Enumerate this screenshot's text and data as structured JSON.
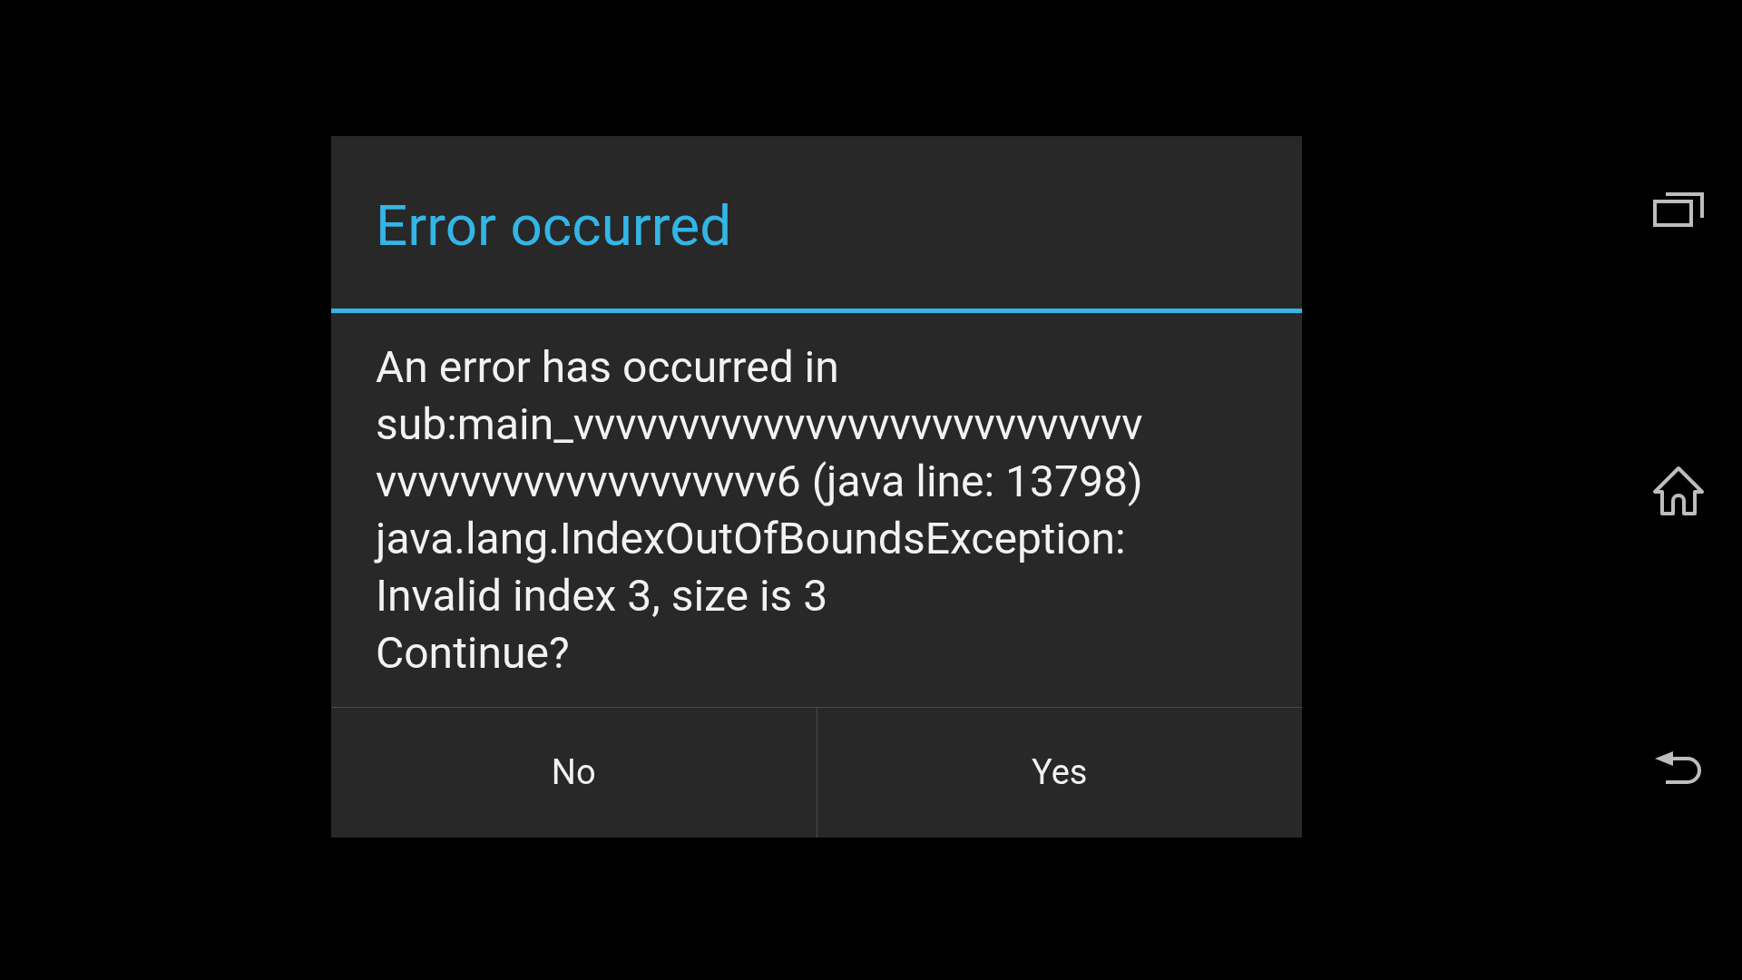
{
  "dialog": {
    "title": "Error occurred",
    "message_lines": [
      "An error has occurred in",
      "sub:main_vvvvvvvvvvvvvvvvvvvvvvvvvvv",
      "vvvvvvvvvvvvvvvvvvv6 (java line: 13798)",
      "java.lang.IndexOutOfBoundsException:",
      "Invalid index 3, size is 3",
      "Continue?"
    ],
    "buttons": [
      "No",
      "Yes"
    ]
  },
  "nav_bar": [
    {
      "kind": "recents"
    },
    {
      "kind": "home"
    },
    {
      "kind": "back"
    }
  ]
}
